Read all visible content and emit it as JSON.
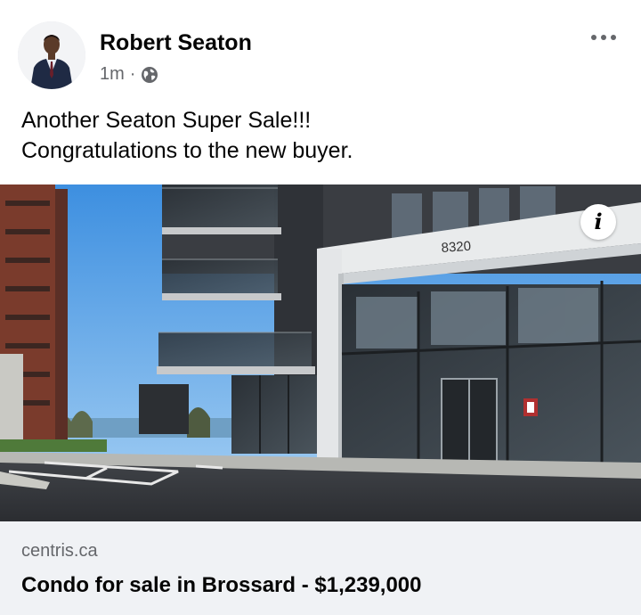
{
  "post": {
    "author_name": "Robert Seaton",
    "timestamp": "1m",
    "separator": "·",
    "audience_icon": "globe-icon",
    "more_icon": "more-horizontal-icon",
    "text_lines": [
      "Another Seaton Super Sale!!!",
      "Congratulations to the new buyer."
    ]
  },
  "photo": {
    "building_number": "8320",
    "info_icon_text": "i"
  },
  "link_preview": {
    "domain": "centris.ca",
    "title": "Condo for sale in Brossard - $1,239,000"
  },
  "colors": {
    "secondary_text": "#65676b",
    "primary_text": "#050505",
    "preview_bg": "#f0f2f5"
  }
}
